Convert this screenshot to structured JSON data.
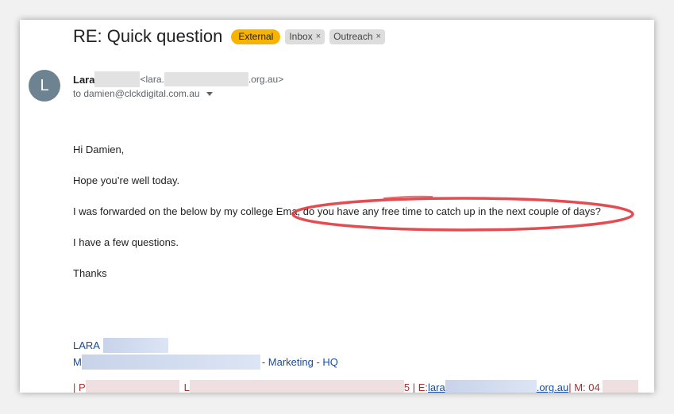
{
  "header": {
    "subject": "RE: Quick question",
    "labels": {
      "external": "External",
      "inbox": "Inbox",
      "outreach": "Outreach",
      "remove_glyph": "×"
    }
  },
  "sender": {
    "avatar_letter": "L",
    "name": "Lara",
    "email_prefix": "<lara.",
    "email_suffix": ".org.au>",
    "to_line": "to damien@clckdigital.com.au"
  },
  "body": {
    "greeting": "Hi Damien,",
    "line1": "Hope you’re well today.",
    "line2_start": "I was forwarded on the below by my college Em",
    "line2_end": "a, do you have any free time to catch up in the next couple of days?",
    "line3": "I have a few questions.",
    "signoff": "Thanks"
  },
  "signature": {
    "name": "LARA",
    "title_start": "M",
    "title_end": "- Marketing - HQ",
    "contact_start": "| P",
    "contact_mid1": "5 | E: ",
    "email_start": "lara",
    "email_end": ".org.au",
    "contact_mid2": " | M: 04"
  },
  "colors": {
    "external_badge": "#f6b400",
    "link": "#1a4b9b",
    "highlight_ellipse": "#e0393e"
  }
}
